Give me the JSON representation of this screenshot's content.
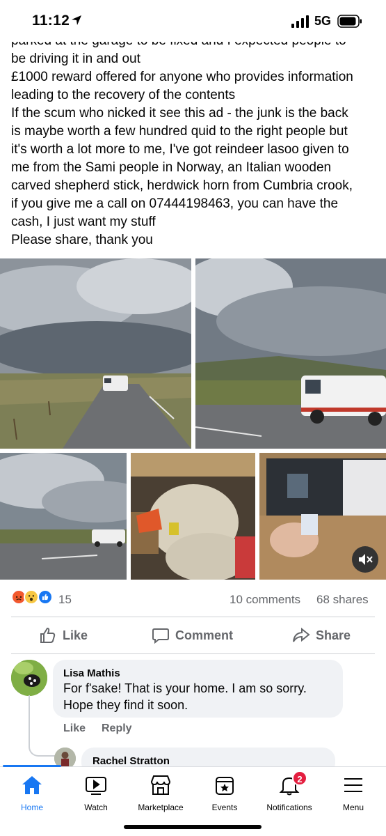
{
  "status_bar": {
    "time": "11:12",
    "network": "5G"
  },
  "post": {
    "lines": [
      "parked at the garage to be fixed and I expected people to",
      "be driving it in and out",
      "£1000 reward offered for anyone who provides information",
      "leading to the recovery of the contents",
      "If the scum who nicked it see this ad - the junk is the back",
      "is maybe worth a few hundred quid to the right people but",
      "it's worth a lot more to me, I've got reindeer lasoo given to",
      "me from the Sami people in Norway, an Italian wooden",
      "carved shepherd stick, herdwick horn from Cumbria crook,",
      "if you give me a call on 07444198463, you can have the",
      "cash, I just want my stuff",
      "Please share, thank you"
    ]
  },
  "reactions": {
    "count": "15",
    "icons": [
      "angry-icon",
      "wow-icon",
      "like-icon"
    ],
    "comments": "10 comments",
    "shares": "68 shares"
  },
  "actions": {
    "like": "Like",
    "comment": "Comment",
    "share": "Share"
  },
  "comments": [
    {
      "name": "Lisa Mathis",
      "text_lines": [
        "For f'sake! That is your home. I am so sorry.",
        "Hope they find it soon."
      ],
      "like": "Like",
      "reply": "Reply"
    },
    {
      "name": "Rachel Stratton"
    }
  ],
  "tabbar": {
    "items": [
      {
        "label": "Home",
        "icon": "home-icon",
        "active": true
      },
      {
        "label": "Watch",
        "icon": "watch-icon"
      },
      {
        "label": "Marketplace",
        "icon": "marketplace-icon"
      },
      {
        "label": "Events",
        "icon": "events-icon"
      },
      {
        "label": "Notifications",
        "icon": "bell-icon",
        "badge": "2"
      },
      {
        "label": "Menu",
        "icon": "menu-icon"
      }
    ]
  },
  "colors": {
    "accent": "#1877f2",
    "muted": "#65676b",
    "badge": "#e41e3f"
  }
}
